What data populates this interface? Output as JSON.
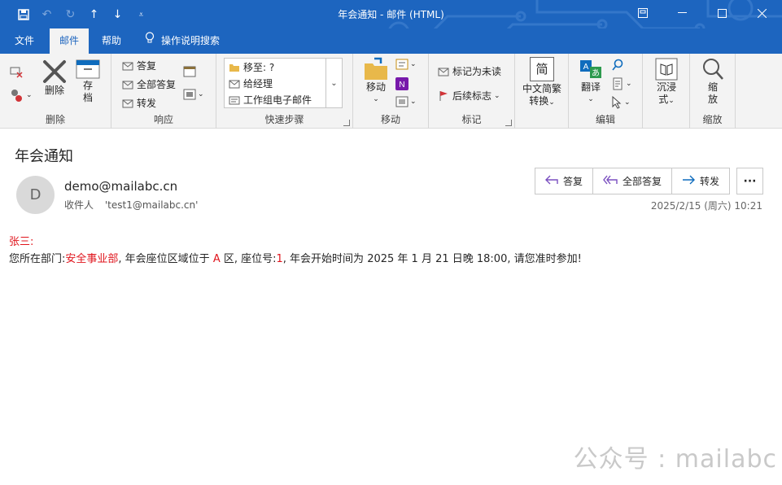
{
  "window": {
    "title": "年会通知  -  邮件 (HTML)"
  },
  "tabs": {
    "file": "文件",
    "mail": "邮件",
    "help": "帮助",
    "search": "操作说明搜索"
  },
  "ribbon": {
    "delete_group": {
      "delete": "删除",
      "archive_1": "存",
      "archive_2": "档",
      "label": "删除"
    },
    "respond_group": {
      "reply": "答复",
      "reply_all": "全部答复",
      "forward": "转发",
      "label": "响应"
    },
    "quick_steps": {
      "items": [
        "移至: ?",
        "给经理",
        "工作组电子邮件"
      ],
      "label": "快速步骤"
    },
    "move_group": {
      "move": "移动",
      "label": "移动"
    },
    "tags_group": {
      "mark_unread": "标记为未读",
      "follow_up": "后续标志",
      "label": "标记"
    },
    "chinese_group": {
      "line1": "中文简繁",
      "line2": "转换",
      "icon_char": "简"
    },
    "edit_group": {
      "translate": "翻译",
      "label": "编辑"
    },
    "immersive_group": {
      "line1": "沉浸",
      "line2": "式"
    },
    "zoom_group": {
      "line1": "缩",
      "line2": "放",
      "label": "缩放"
    }
  },
  "message": {
    "subject": "年会通知",
    "avatar_letter": "D",
    "from": "demo@mailabc.cn",
    "to_label": "收件人",
    "to": "'test1@mailabc.cn'",
    "datetime": "2025/2/15 (周六) 10:21",
    "actions": {
      "reply": "答复",
      "reply_all": "全部答复",
      "forward": "转发",
      "more": "···"
    },
    "greeting": "张三:",
    "body": {
      "p1": "您所在部门:",
      "dept": "安全事业部",
      "p2": ", 年会座位区域位于",
      "zone": "A",
      "p3": "区, 座位号:",
      "seat": "1",
      "p4": ", 年会开始时间为 2025 年 1 月 21 日晚 18:00, 请您准时参加!"
    }
  },
  "watermark": "公众号 : mailabc",
  "colors": {
    "accent": "#1d65bf",
    "highlight": "#e0151d"
  }
}
